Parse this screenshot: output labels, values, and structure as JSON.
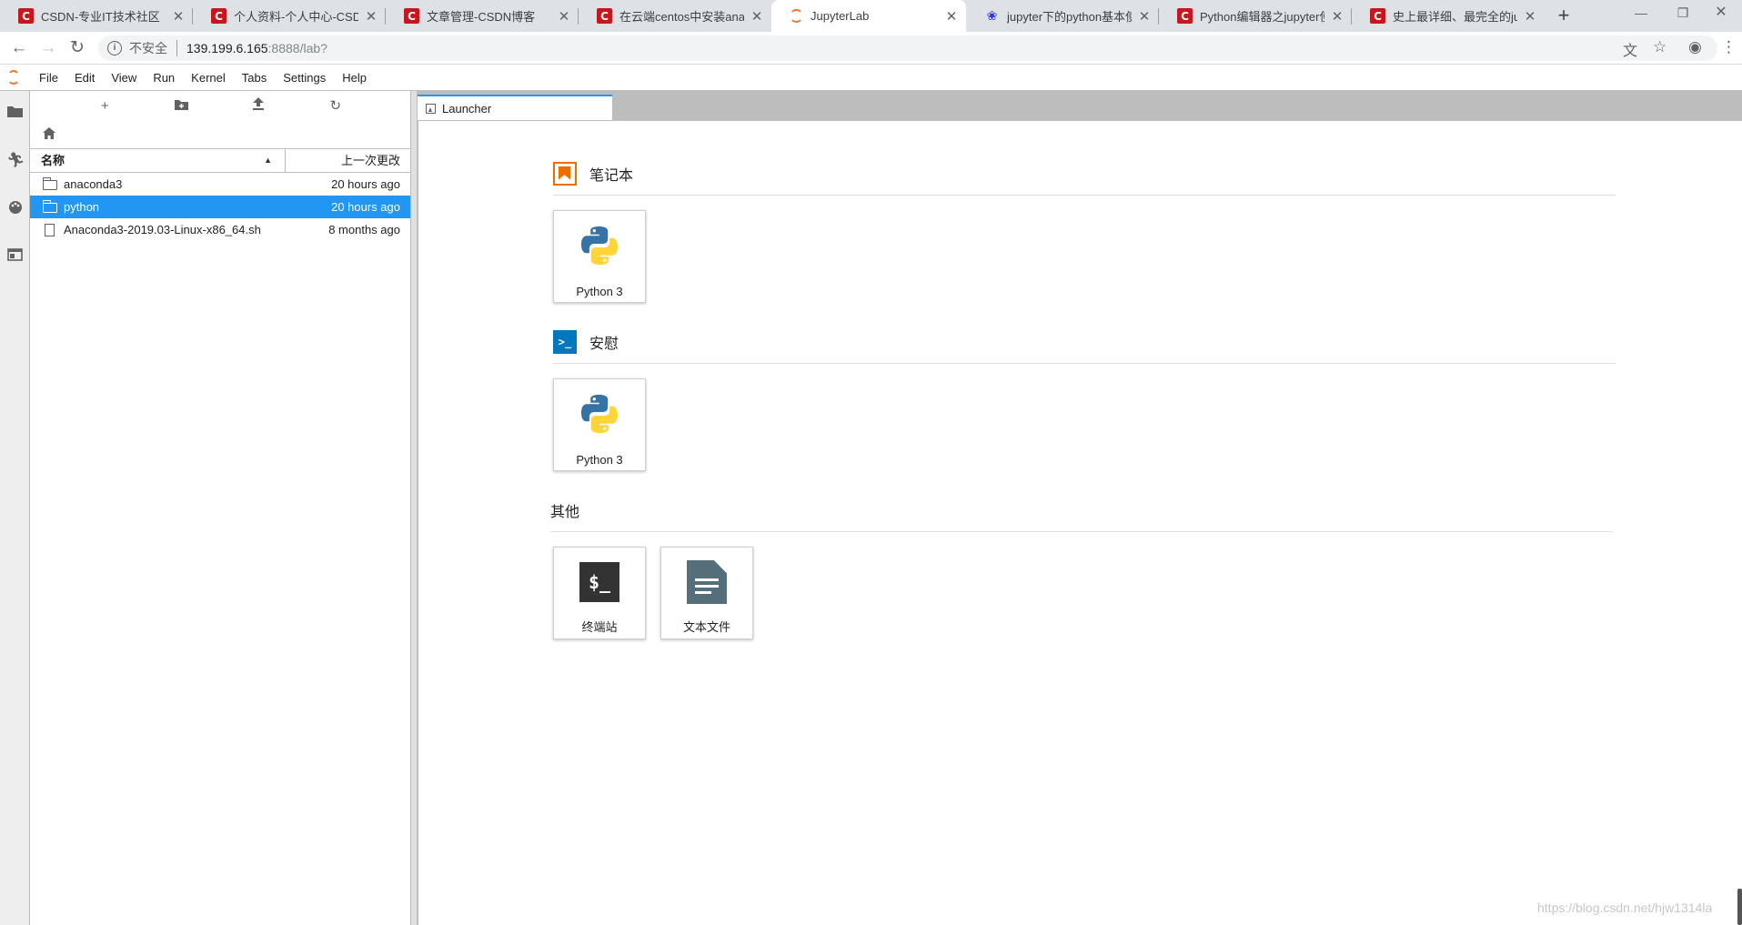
{
  "browser": {
    "tabs": [
      {
        "title": "CSDN-专业IT技术社区",
        "favicon": "csdn-icon"
      },
      {
        "title": "个人资料-个人中心-CSDN",
        "favicon": "csdn-icon"
      },
      {
        "title": "文章管理-CSDN博客",
        "favicon": "csdn-icon"
      },
      {
        "title": "在云端centos中安装anaco",
        "favicon": "csdn-icon"
      },
      {
        "title": "JupyterLab",
        "favicon": "jupyter-icon",
        "active": true
      },
      {
        "title": "jupyter下的python基本使用",
        "favicon": "baidu-paw-icon"
      },
      {
        "title": "Python编辑器之jupyter使用",
        "favicon": "csdn-icon"
      },
      {
        "title": "史上最详细、最完全的jupy",
        "favicon": "csdn-icon"
      }
    ],
    "tab_close": "✕",
    "new_tab": "+",
    "address": {
      "security_label": "不安全",
      "host": "139.199.6.165",
      "path": ":8888/lab?"
    }
  },
  "menubar": {
    "items": [
      "File",
      "Edit",
      "View",
      "Run",
      "Kernel",
      "Tabs",
      "Settings",
      "Help"
    ]
  },
  "filebrowser": {
    "columns": {
      "name": "名称",
      "modified": "上一次更改"
    },
    "rows": [
      {
        "name": "anaconda3",
        "type": "folder",
        "modified": "20 hours ago",
        "selected": false
      },
      {
        "name": "python",
        "type": "folder",
        "modified": "20 hours ago",
        "selected": true
      },
      {
        "name": "Anaconda3-2019.03-Linux-x86_64.sh",
        "type": "file",
        "modified": "8 months ago",
        "selected": false
      }
    ]
  },
  "dock": {
    "tab_title": "Launcher"
  },
  "launcher": {
    "notebook": {
      "title": "笔记本",
      "cards": [
        {
          "label": "Python 3"
        }
      ]
    },
    "console": {
      "title": "安慰",
      "cards": [
        {
          "label": "Python 3"
        }
      ]
    },
    "other": {
      "title": "其他",
      "cards": [
        {
          "label": "终端站"
        },
        {
          "label": "文本文件"
        }
      ]
    }
  },
  "watermark": "https://blog.csdn.net/hjw1314la",
  "colors": {
    "selection": "#2196f3",
    "jupyter_orange": "#f37726",
    "notebook_orange": "#ef6c00",
    "console_blue": "#0277bd"
  }
}
